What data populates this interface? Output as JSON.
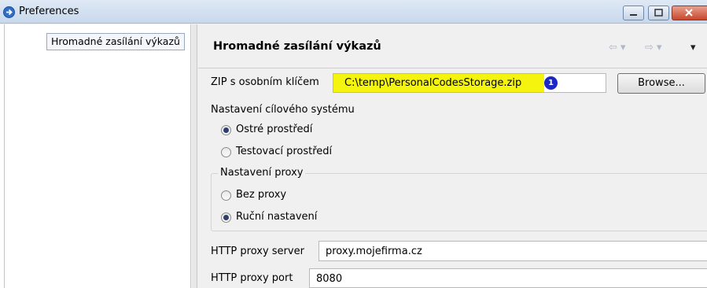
{
  "window": {
    "title": "Preferences"
  },
  "tree": {
    "items": [
      {
        "label": "Hromadné zasílání výkazů"
      }
    ]
  },
  "page": {
    "title": "Hromadné zasílání výkazů",
    "nav": {
      "back": "⇦ ▾",
      "forward": "⇨ ▾",
      "menu": "▾"
    }
  },
  "zip": {
    "label": "ZIP s osobním klíčem",
    "value": "C:\\temp\\PersonalCodesStorage.zip",
    "badge": "1",
    "browse_label": "Browse..."
  },
  "target_system": {
    "label": "Nastavení cílového systému",
    "options": [
      {
        "label": "Ostré prostředí",
        "selected": true
      },
      {
        "label": "Testovací prostředí",
        "selected": false
      }
    ]
  },
  "proxy": {
    "group_label": "Nastavení proxy",
    "options": [
      {
        "label": "Bez proxy",
        "selected": false
      },
      {
        "label": "Ruční nastavení",
        "selected": true
      }
    ],
    "server_label": "HTTP proxy server",
    "server_value": "proxy.mojefirma.cz",
    "port_label": "HTTP proxy port",
    "port_value": "8080"
  },
  "colors": {
    "highlight": "#f4f40e",
    "badge": "#1b28c4"
  }
}
